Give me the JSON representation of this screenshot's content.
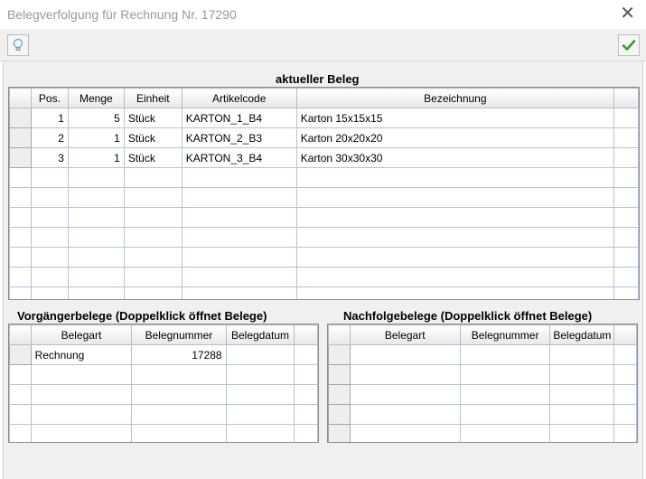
{
  "window": {
    "title": "Belegverfolgung für Rechnung Nr. 17290",
    "close_symbol": "✕"
  },
  "toolbar": {
    "hint_icon": "lightbulb-icon",
    "ok_icon": "checkmark-icon"
  },
  "current": {
    "title": "aktueller Beleg",
    "columns": [
      "Pos.",
      "Menge",
      "Einheit",
      "Artikelcode",
      "Bezeichnung"
    ],
    "rows": [
      {
        "pos": "1",
        "menge": "5",
        "einheit": "Stück",
        "artikelcode": "KARTON_1_B4",
        "bezeichnung": "Karton 15x15x15"
      },
      {
        "pos": "2",
        "menge": "1",
        "einheit": "Stück",
        "artikelcode": "KARTON_2_B3",
        "bezeichnung": "Karton 20x20x20"
      },
      {
        "pos": "3",
        "menge": "1",
        "einheit": "Stück",
        "artikelcode": "KARTON_3_B4",
        "bezeichnung": "Karton 30x30x30"
      }
    ]
  },
  "predecessors": {
    "title": "Vorgängerbelege (Doppelklick öffnet Belege)",
    "columns": [
      "Belegart",
      "Belegnummer",
      "Belegdatum"
    ],
    "rows": [
      {
        "belegart": "Rechnung",
        "belegnummer": "17288",
        "belegdatum": ""
      }
    ]
  },
  "successors": {
    "title": "Nachfolgebelege (Doppelklick öffnet Belege)",
    "columns": [
      "Belegart",
      "Belegnummer",
      "Belegdatum"
    ],
    "rows": []
  }
}
